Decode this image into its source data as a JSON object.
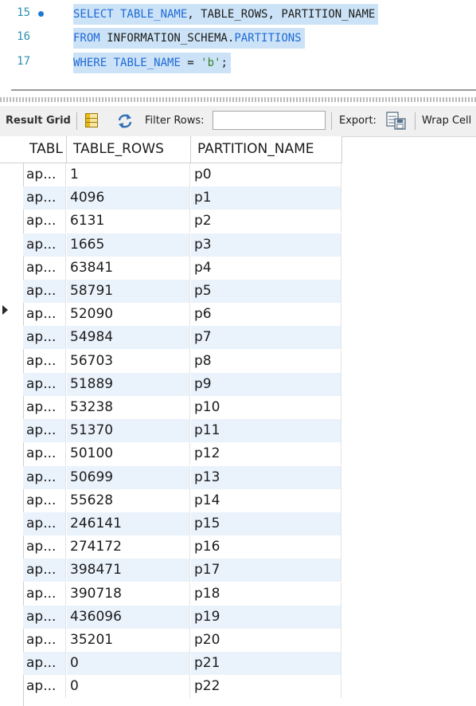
{
  "editor": {
    "lines": [
      {
        "number": "15",
        "segments": [
          {
            "text": "SELECT",
            "kind": "kw"
          },
          {
            "text": " TABLE_NAME",
            "kind": "kw"
          },
          {
            "text": ", ",
            "kind": "obj"
          },
          {
            "text": "TABLE_ROWS",
            "kind": "obj"
          },
          {
            "text": ", ",
            "kind": "obj"
          },
          {
            "text": "PARTITION_NAME",
            "kind": "obj"
          }
        ]
      },
      {
        "number": "16",
        "segments": [
          {
            "text": "FROM",
            "kind": "kw"
          },
          {
            "text": " INFORMATION_SCHEMA",
            "kind": "obj"
          },
          {
            "text": ".",
            "kind": "obj"
          },
          {
            "text": "PARTITIONS",
            "kind": "kw"
          }
        ]
      },
      {
        "number": "17",
        "segments": [
          {
            "text": "WHERE",
            "kind": "kw"
          },
          {
            "text": " TABLE_NAME",
            "kind": "kw"
          },
          {
            "text": " = ",
            "kind": "obj"
          },
          {
            "text": "'b'",
            "kind": "str"
          },
          {
            "text": ";",
            "kind": "obj"
          }
        ]
      }
    ]
  },
  "toolbar": {
    "result_grid_label": "Result Grid",
    "filter_rows_label": "Filter Rows:",
    "filter_rows_value": "",
    "export_label": "Export:",
    "wrap_cell_label": "Wrap Cell"
  },
  "grid": {
    "columns": [
      "TABLE_NAME",
      "TABLE_ROWS",
      "PARTITION_NAME"
    ],
    "column_display": [
      "TABL",
      "TABLE_ROWS",
      "PARTITION_NAME"
    ],
    "rows": [
      [
        "ap...",
        "1",
        "p0"
      ],
      [
        "ap...",
        "4096",
        "p1"
      ],
      [
        "ap...",
        "6131",
        "p2"
      ],
      [
        "ap...",
        "1665",
        "p3"
      ],
      [
        "ap...",
        "63841",
        "p4"
      ],
      [
        "ap...",
        "58791",
        "p5"
      ],
      [
        "ap...",
        "52090",
        "p6"
      ],
      [
        "ap...",
        "54984",
        "p7"
      ],
      [
        "ap...",
        "56703",
        "p8"
      ],
      [
        "ap...",
        "51889",
        "p9"
      ],
      [
        "ap...",
        "53238",
        "p10"
      ],
      [
        "ap...",
        "51370",
        "p11"
      ],
      [
        "ap...",
        "50100",
        "p12"
      ],
      [
        "ap...",
        "50699",
        "p13"
      ],
      [
        "ap...",
        "55628",
        "p14"
      ],
      [
        "ap...",
        "246141",
        "p15"
      ],
      [
        "ap...",
        "274172",
        "p16"
      ],
      [
        "ap...",
        "398471",
        "p17"
      ],
      [
        "ap...",
        "390718",
        "p18"
      ],
      [
        "ap...",
        "436096",
        "p19"
      ],
      [
        "ap...",
        "35201",
        "p20"
      ],
      [
        "ap...",
        "0",
        "p21"
      ],
      [
        "ap...",
        "0",
        "p22"
      ]
    ]
  },
  "colors": {
    "keyword": "#1f69d6",
    "selection": "#cce3f7",
    "alt_row": "#eaf2fc",
    "string": "#3a7f2e"
  },
  "icons": {
    "exec_marker": "dot-icon",
    "result_grid": "grid-icon",
    "refresh": "refresh-icon",
    "export": "export-icon",
    "row_pointer": "row-pointer-icon"
  }
}
